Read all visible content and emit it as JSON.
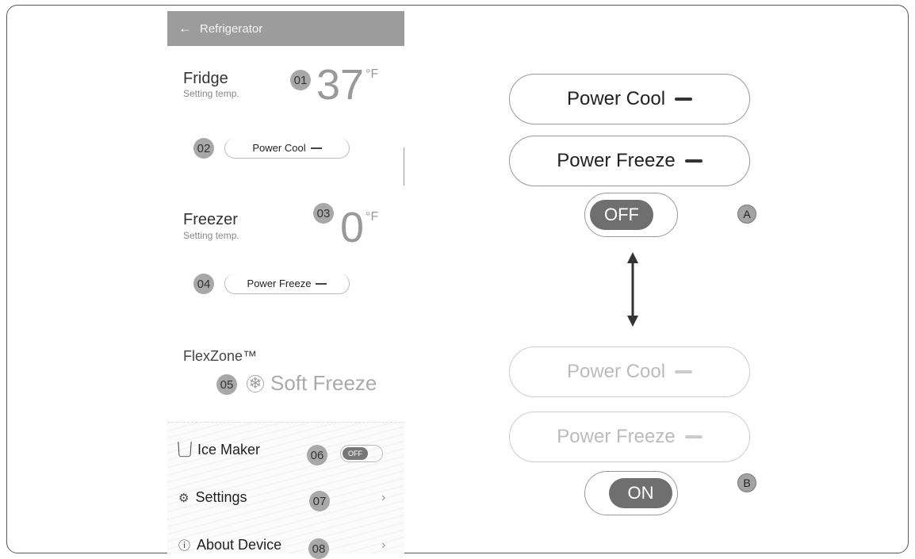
{
  "appbar": {
    "title": "Refrigerator",
    "back_icon": "arrow-left-icon"
  },
  "callouts": [
    "01",
    "02",
    "03",
    "04",
    "05",
    "06",
    "07",
    "08"
  ],
  "fridge": {
    "title": "Fridge",
    "subtitle": "Setting temp.",
    "temp": "37",
    "unit": "°F",
    "button": "Power Cool"
  },
  "freezer": {
    "title": "Freezer",
    "subtitle": "Setting temp.",
    "temp": "0",
    "unit": "°F",
    "button": "Power Freeze"
  },
  "flexzone": {
    "title": "FlexZone™",
    "mode": "Soft Freeze",
    "mode_icon": "snowflake-icon"
  },
  "menu": {
    "ice_maker": {
      "label": "Ice Maker",
      "toggle": "OFF"
    },
    "settings": {
      "label": "Settings"
    },
    "about": {
      "label": "About Device"
    },
    "chevron": "›"
  },
  "diagram": {
    "a": {
      "letter": "A",
      "cool": "Power Cool",
      "freeze": "Power Freeze",
      "toggle": "OFF"
    },
    "b": {
      "letter": "B",
      "cool": "Power Cool",
      "freeze": "Power Freeze",
      "toggle": "ON"
    }
  }
}
